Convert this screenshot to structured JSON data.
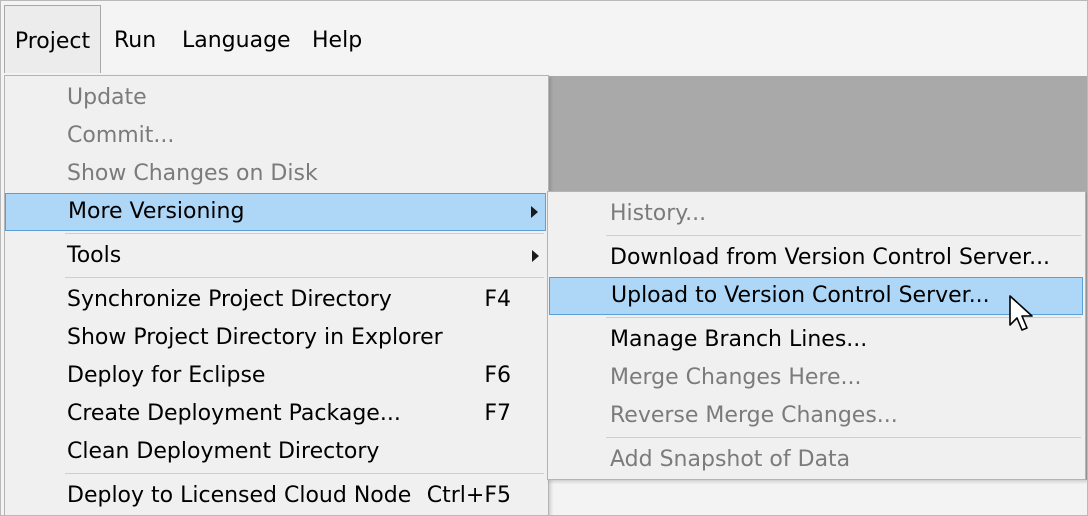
{
  "menubar": {
    "items": [
      {
        "label": "Project"
      },
      {
        "label": "Run"
      },
      {
        "label": "Language"
      },
      {
        "label": "Help"
      }
    ]
  },
  "project_menu": {
    "items": [
      {
        "label": "Update",
        "state": "disabled"
      },
      {
        "label": "Commit...",
        "state": "disabled"
      },
      {
        "label": "Show Changes on Disk",
        "state": "disabled"
      },
      {
        "label": "More Versioning",
        "state": "highlighted",
        "submenu": true
      },
      {
        "label": "Tools",
        "submenu": true
      },
      {
        "label": "Synchronize Project Directory",
        "shortcut": "F4"
      },
      {
        "label": "Show Project Directory in Explorer"
      },
      {
        "label": "Deploy for Eclipse",
        "shortcut": "F6"
      },
      {
        "label": "Create Deployment Package...",
        "shortcut": "F7"
      },
      {
        "label": "Clean Deployment Directory"
      },
      {
        "label": "Deploy to Licensed Cloud Node",
        "shortcut": "Ctrl+F5"
      }
    ]
  },
  "versioning_submenu": {
    "items": [
      {
        "label": "History...",
        "state": "disabled"
      },
      {
        "label": "Download from Version Control Server..."
      },
      {
        "label": "Upload to Version Control Server...",
        "state": "highlighted"
      },
      {
        "label": "Manage Branch Lines..."
      },
      {
        "label": "Merge Changes Here...",
        "state": "disabled"
      },
      {
        "label": "Reverse Merge Changes...",
        "state": "disabled"
      },
      {
        "label": "Add Snapshot of Data",
        "state": "disabled"
      }
    ]
  },
  "colors": {
    "highlight_fill": "#aed6f6",
    "highlight_border": "#5d9fd8",
    "disabled_text": "#7b7b7b",
    "backdrop": "#a9a9a9"
  },
  "icons": {
    "submenu_arrow": "triangle-right-icon",
    "pointer": "mouse-cursor-icon"
  }
}
